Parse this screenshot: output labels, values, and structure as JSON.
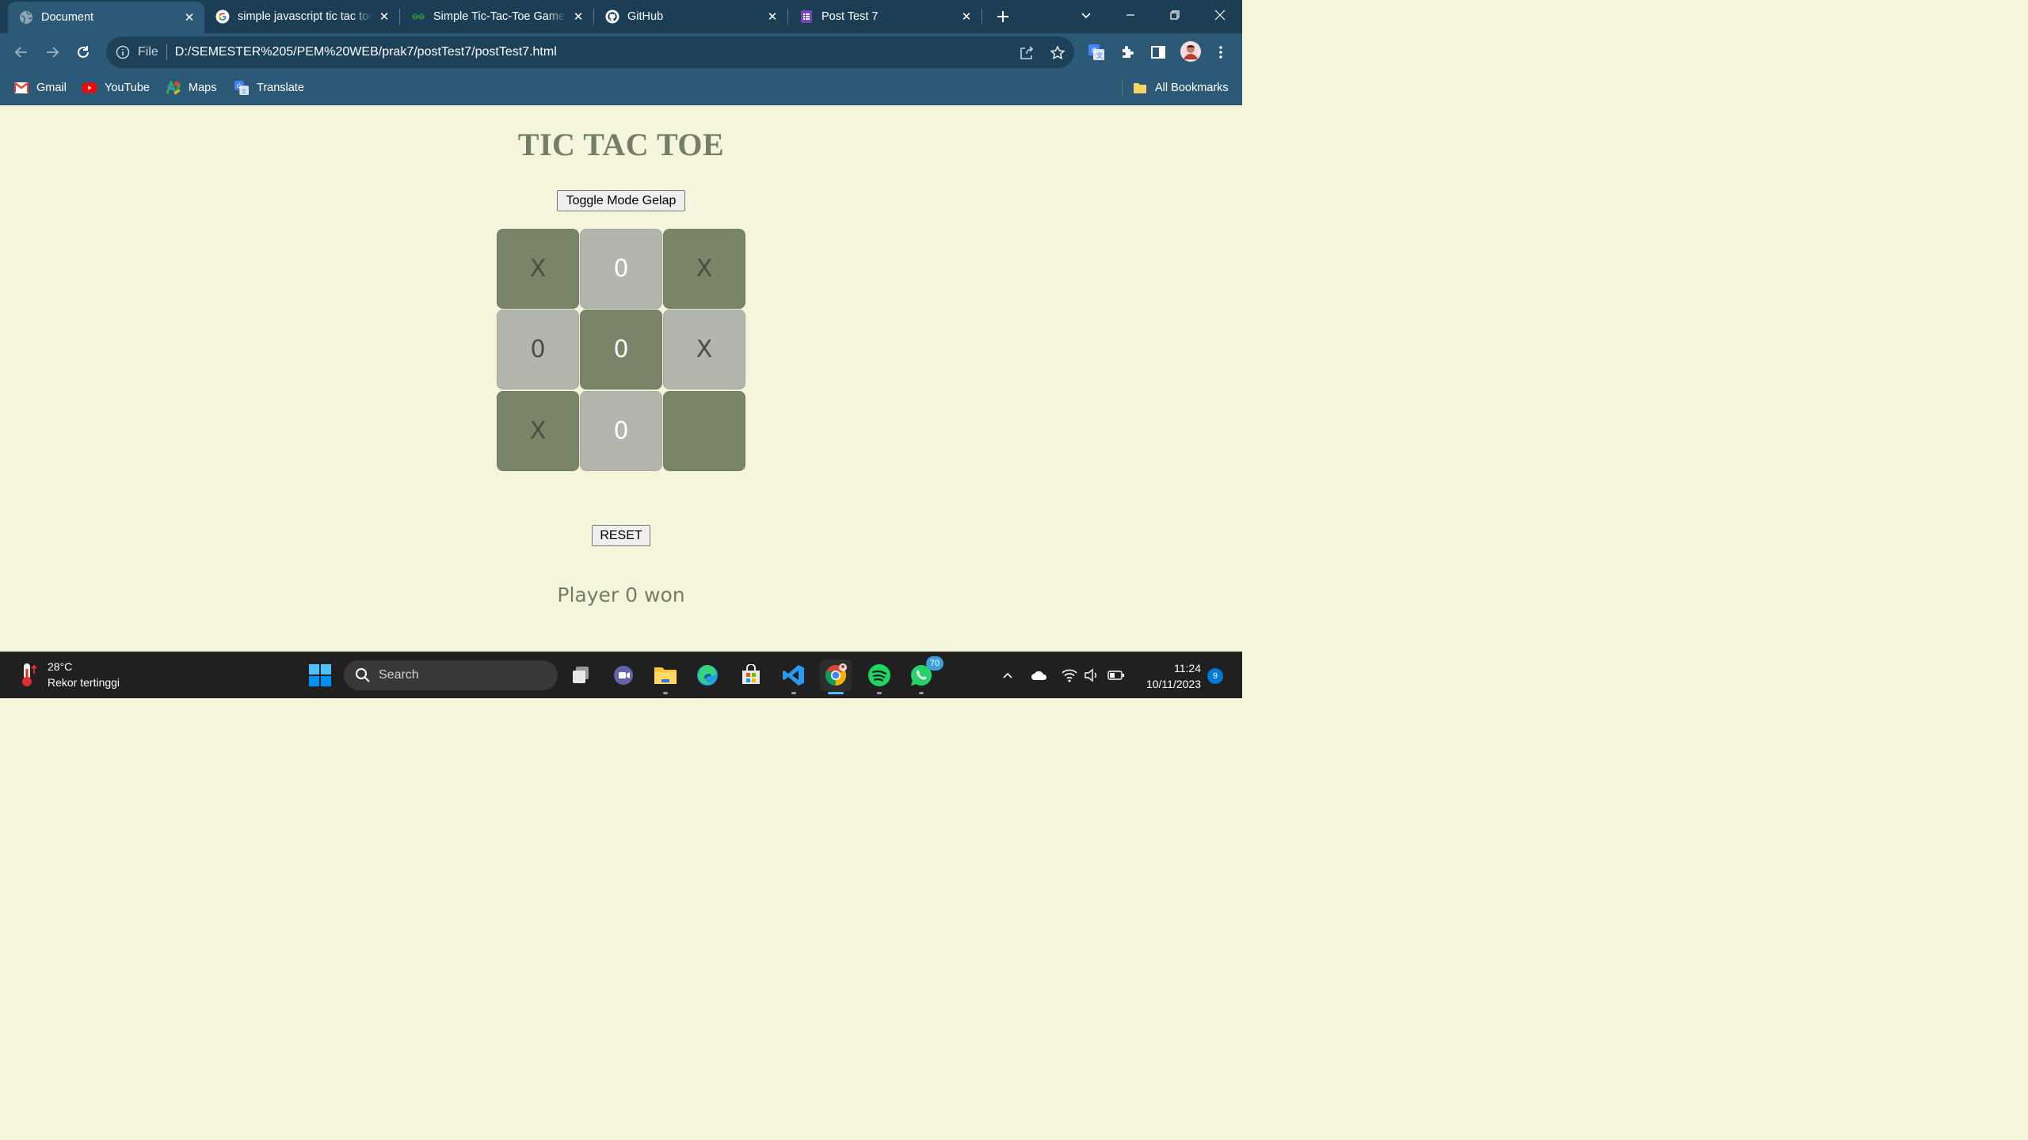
{
  "browser": {
    "tabs": [
      {
        "title": "Document",
        "active": true,
        "icon": "globe-icon"
      },
      {
        "title": "simple javascript tic tac toe",
        "active": false,
        "icon": "google-icon"
      },
      {
        "title": "Simple Tic-Tac-Toe Game",
        "active": false,
        "icon": "geeksforgeeks-icon"
      },
      {
        "title": "GitHub",
        "active": false,
        "icon": "github-icon"
      },
      {
        "title": "Post Test 7",
        "active": false,
        "icon": "forms-icon"
      }
    ],
    "address": {
      "scheme": "File",
      "url": "D:/SEMESTER%205/PEM%20WEB/prak7/postTest7/postTest7.html"
    },
    "bookmarks": [
      {
        "label": "Gmail",
        "icon": "gmail-icon"
      },
      {
        "label": "YouTube",
        "icon": "youtube-icon"
      },
      {
        "label": "Maps",
        "icon": "maps-icon"
      },
      {
        "label": "Translate",
        "icon": "translate-icon"
      }
    ],
    "all_bookmarks": "All Bookmarks"
  },
  "game": {
    "title": "TIC TAC TOE",
    "toggle_label": "Toggle Mode Gelap",
    "board": [
      "X",
      "0",
      "X",
      "0",
      "0",
      "X",
      "X",
      "0",
      ""
    ],
    "reset_label": "RESET",
    "status": "Player 0 won"
  },
  "taskbar": {
    "weather": {
      "temp": "28°C",
      "desc": "Rekor tertinggi"
    },
    "search_placeholder": "Search",
    "whatsapp_badge": "70",
    "clock": {
      "time": "11:24",
      "date": "10/11/2023"
    },
    "notifications": "9"
  },
  "colors": {
    "page_bg": "#f5f5dc",
    "title": "#737e62",
    "cell_dark": "#7a8467",
    "cell_light": "#b2b6ac",
    "chrome_frame": "#1c3e55",
    "chrome_toolbar": "#2c5a76"
  }
}
